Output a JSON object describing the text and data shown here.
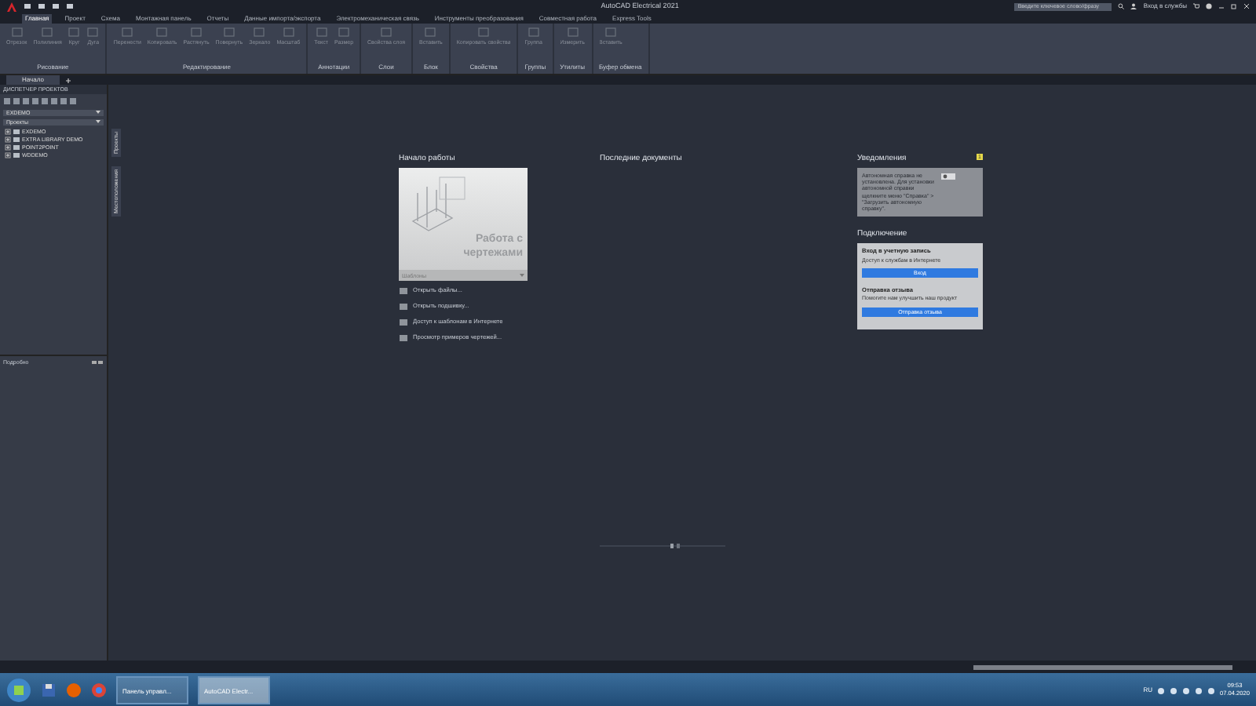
{
  "title_bar": {
    "title": "AutoCAD Electrical 2021",
    "search": {
      "placeholder": "Введите ключевое слово/фразу"
    },
    "sign_in": "Вход в службы"
  },
  "ribbon": {
    "tabs": [
      {
        "label": "Главная",
        "selected": true
      },
      {
        "label": "Проект",
        "selected": false
      },
      {
        "label": "Схема",
        "selected": false
      },
      {
        "label": "Монтажная панель",
        "selected": false
      },
      {
        "label": "Отчеты",
        "selected": false
      },
      {
        "label": "Данные импорта/экспорта",
        "selected": false
      },
      {
        "label": "Электромеханическая связь",
        "selected": false
      },
      {
        "label": "Инструменты преобразования",
        "selected": false
      },
      {
        "label": "Совместная работа",
        "selected": false
      },
      {
        "label": "Express Tools",
        "selected": false
      }
    ],
    "panels": [
      {
        "title": "Рисование",
        "tools": [
          "Отрезок",
          "Полилиния",
          "Круг",
          "Дуга"
        ]
      },
      {
        "title": "Редактирование",
        "tools": [
          "Перенести",
          "Копировать",
          "Растянуть",
          "Повернуть",
          "Зеркало",
          "Масштаб"
        ]
      },
      {
        "title": "Аннотации",
        "tools": [
          "Текст",
          "Размер"
        ]
      },
      {
        "title": "Слои",
        "tools": [
          "Свойства слоя"
        ]
      },
      {
        "title": "Блок",
        "tools": [
          "Вставить"
        ]
      },
      {
        "title": "Свойства",
        "tools": [
          "Копировать свойства"
        ]
      },
      {
        "title": "Группы",
        "tools": [
          "Группа"
        ]
      },
      {
        "title": "Утилиты",
        "tools": [
          "Измерить"
        ]
      },
      {
        "title": "Буфер обмена",
        "tools": [
          "Вставить"
        ]
      }
    ]
  },
  "doc_tabs": [
    {
      "label": "Начало",
      "selected": true
    }
  ],
  "project_manager": {
    "title": "ДИСПЕТЧЕР ПРОЕКТОВ",
    "dropdown": "EXDEMO",
    "section": "Проекты",
    "projects": [
      {
        "name": "EXDEMO",
        "expanded": false
      },
      {
        "name": "EXTRA LIBRARY DEMO",
        "expanded": false
      },
      {
        "name": "POINT2POINT",
        "expanded": false
      },
      {
        "name": "WDDEMO",
        "expanded": false
      }
    ],
    "side_tabs": [
      "Проекты",
      "Местоположения"
    ],
    "details": "Подробно"
  },
  "start_page": {
    "get_started": {
      "heading": "Начало работы",
      "card_title": "Работа с чертежами",
      "templates": "Шаблоны",
      "links": [
        "Открыть файлы...",
        "Открыть подшивку...",
        "Доступ к шаблонам в Интернете",
        "Просмотр примеров чертежей..."
      ]
    },
    "recent": {
      "heading": "Последние документы"
    },
    "notifications": {
      "heading": "Уведомления",
      "count": "1",
      "text": "Автономная справка не установлена. Для установки автономной справки щелкните меню \"Справка\" > \"Загрузить автономную справку\"."
    },
    "connect": {
      "heading": "Подключение",
      "sign_in_title": "Вход в учетную запись",
      "sign_in_text": "Доступ к службам в Интернете",
      "sign_in_button": "Вход",
      "feedback_title": "Отправка отзыва",
      "feedback_text": "Помогите нам улучшить наш продукт",
      "feedback_button": "Отправка отзыва"
    }
  },
  "taskbar": {
    "windows": [
      {
        "label": "Панель управл...",
        "selected": false
      },
      {
        "label": "AutoCAD Electr...",
        "selected": true
      }
    ],
    "language": "RU",
    "time": "09:53",
    "date": "07.04.2020"
  }
}
